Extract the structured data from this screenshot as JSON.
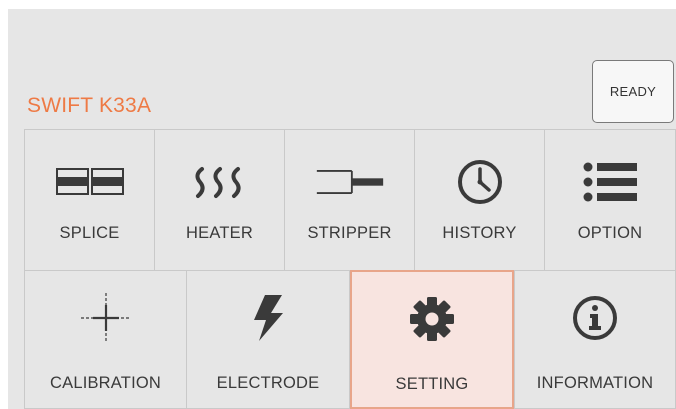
{
  "header": {
    "brand": "SWIFT K33A",
    "status_button": "READY"
  },
  "menu": {
    "row1": [
      {
        "label": "SPLICE",
        "icon": "splice-icon"
      },
      {
        "label": "HEATER",
        "icon": "heater-icon"
      },
      {
        "label": "STRIPPER",
        "icon": "stripper-icon"
      },
      {
        "label": "HISTORY",
        "icon": "clock-icon"
      },
      {
        "label": "OPTION",
        "icon": "list-icon"
      }
    ],
    "row2": [
      {
        "label": "CALIBRATION",
        "icon": "crosshair-icon"
      },
      {
        "label": "ELECTRODE",
        "icon": "lightning-icon"
      },
      {
        "label": "SETTING",
        "icon": "gear-icon",
        "selected": true
      },
      {
        "label": "INFORMATION",
        "icon": "info-icon"
      }
    ]
  },
  "colors": {
    "brand": "#ee7a45",
    "selected_bg": "#f8e4e0",
    "selected_border": "#e8a58a",
    "icon": "#3a3a3a"
  }
}
